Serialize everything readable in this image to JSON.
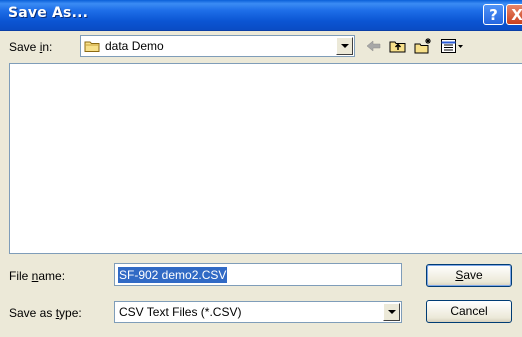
{
  "window": {
    "title": "Save As...",
    "help_glyph": "?",
    "close_glyph": "X"
  },
  "toolbar": {
    "save_in_label_pre": "Save ",
    "save_in_label_key": "i",
    "save_in_label_post": "n:",
    "current_folder": "data Demo",
    "icons": [
      "back-arrow-icon",
      "up-one-level-icon",
      "create-new-folder-icon",
      "views-menu-icon"
    ]
  },
  "file_list": {
    "items": []
  },
  "fields": {
    "file_name_label_pre": "File ",
    "file_name_label_key": "n",
    "file_name_label_post": "ame:",
    "file_name_value": "SF-902 demo2.CSV",
    "save_type_label_pre": "Save as ",
    "save_type_label_key": "t",
    "save_type_label_post": "ype:",
    "save_type_value": "CSV Text Files (*.CSV)"
  },
  "buttons": {
    "save_key": "S",
    "save_rest": "ave",
    "cancel_label": "Cancel"
  },
  "colors": {
    "titlebar": "#0b55d3",
    "dialog_bg": "#ece9d8",
    "selection": "#316ac5",
    "field_border": "#7f9db9"
  }
}
